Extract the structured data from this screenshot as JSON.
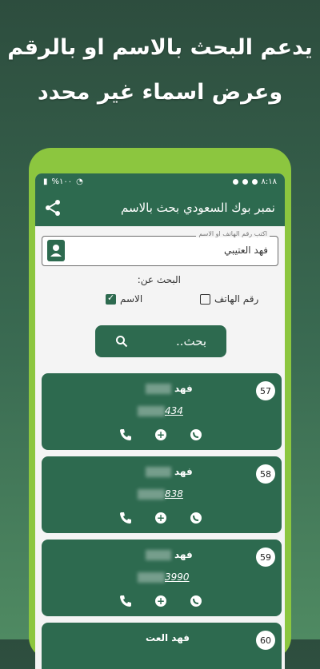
{
  "promo": {
    "line1": "يدعم البحث بالاسم او بالرقم",
    "line2": "وعرض اسماء غير محدد"
  },
  "status": {
    "time": "٨:١٨",
    "battery": "%١٠٠"
  },
  "appbar": {
    "title": "نمبر بوك السعودي بحث بالاسم"
  },
  "search": {
    "label": "اكتب رقم الهاتف او الاسم",
    "value": "فهد العتيبي",
    "search_by": "البحث عن:",
    "option_phone": "رقم الهاتف",
    "option_name": "الاسم",
    "button": "بحث.."
  },
  "results": [
    {
      "index": "57",
      "name": "فهد",
      "number_tail": "434"
    },
    {
      "index": "58",
      "name": "فهد",
      "number_tail": "838"
    },
    {
      "index": "59",
      "name": "فهد",
      "number_tail": "3990"
    },
    {
      "index": "60",
      "name": "فهد العت",
      "number_tail": ""
    }
  ],
  "colors": {
    "primary": "#2d6a4f",
    "phone_frame": "#8cc63f",
    "bg_top": "#2d4d3e"
  }
}
